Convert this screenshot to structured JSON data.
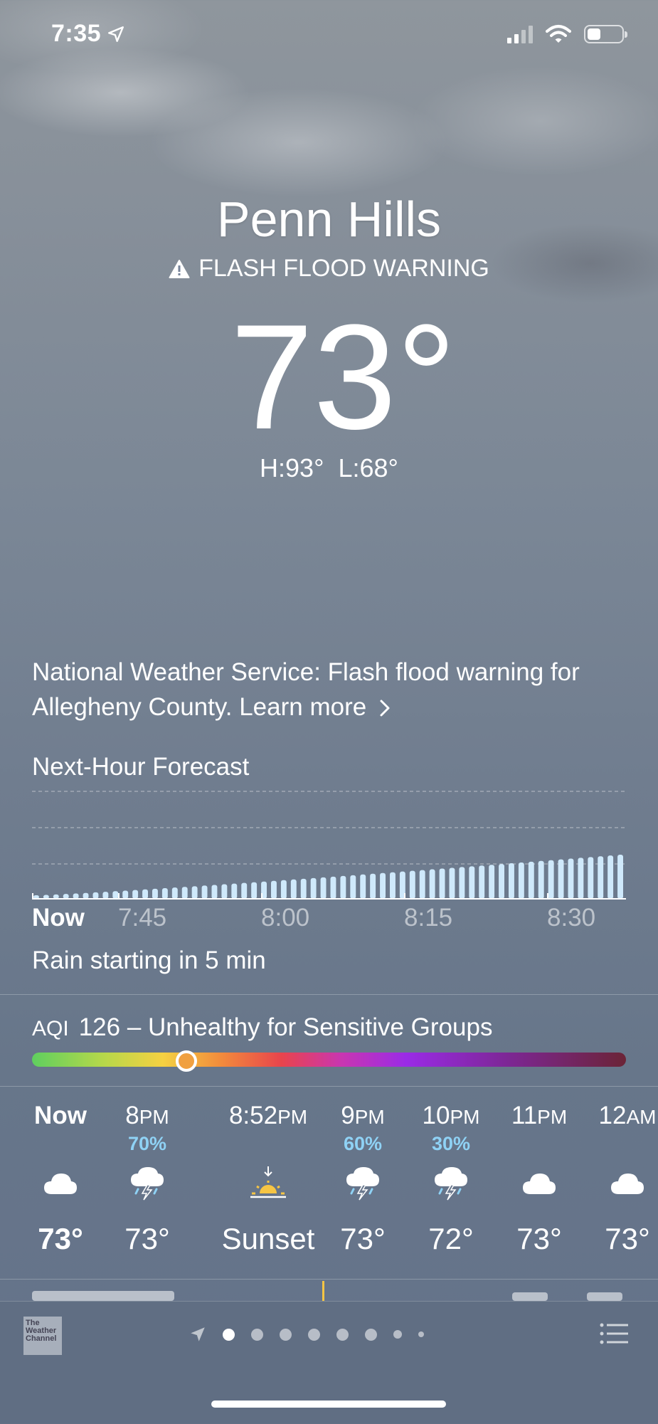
{
  "status_bar": {
    "time": "7:35",
    "icons": [
      "location-arrow-icon",
      "cellular-signal-icon",
      "wifi-icon",
      "battery-icon"
    ]
  },
  "location": {
    "city": "Penn Hills",
    "alert": "FLASH FLOOD WARNING",
    "temperature": "73°",
    "high_low": {
      "high": "H:93°",
      "low": "L:68°"
    }
  },
  "nws_notice": {
    "text": "National Weather Service: Flash flood warning for Allegheny County. ",
    "link": "Learn more",
    "link_icon": "chevron-right-icon"
  },
  "next_hour": {
    "title": "Next-Hour Forecast",
    "time_labels": [
      "Now",
      "7:45",
      "8:00",
      "8:15",
      "8:30"
    ],
    "summary": "Rain starting in 5 min"
  },
  "chart_data": {
    "type": "bar",
    "title": "Next-Hour Forecast",
    "x": [
      "Now",
      "7:45",
      "8:00",
      "8:15",
      "8:30"
    ],
    "intensity_start": 0.08,
    "intensity_end": 1.0,
    "bar_count": 60,
    "gridlines": 3,
    "bar_color": "#cfe9fb"
  },
  "aqi": {
    "label": "AQI",
    "value": "126",
    "separator": "–",
    "category": "Unhealthy for Sensitive Groups",
    "position": 0.26
  },
  "hourly": [
    {
      "time": "Now",
      "suffix": "",
      "pop": "",
      "icon": "cloud-icon",
      "temp": "73°"
    },
    {
      "time": "8",
      "suffix": "PM",
      "pop": "70%",
      "icon": "thunderstorm-rain-icon",
      "temp": "73°"
    },
    {
      "time": "8:52",
      "suffix": "PM",
      "pop": "",
      "icon": "sunset-icon",
      "temp": "Sunset"
    },
    {
      "time": "9",
      "suffix": "PM",
      "pop": "60%",
      "icon": "thunderstorm-rain-icon",
      "temp": "73°"
    },
    {
      "time": "10",
      "suffix": "PM",
      "pop": "30%",
      "icon": "thunderstorm-rain-icon",
      "temp": "72°"
    },
    {
      "time": "11",
      "suffix": "PM",
      "pop": "",
      "icon": "cloud-icon",
      "temp": "73°"
    },
    {
      "time": "12",
      "suffix": "AM",
      "pop": "",
      "icon": "cloud-icon",
      "temp": "73°"
    }
  ],
  "bottom_bar": {
    "logo_text": "The Weather Channel",
    "page_count": 9,
    "active_page": 1,
    "icons": [
      "location-arrow-icon",
      "list-icon"
    ]
  },
  "colors": {
    "precip_text": "#8fd2f5",
    "sun": "#f6c544"
  }
}
